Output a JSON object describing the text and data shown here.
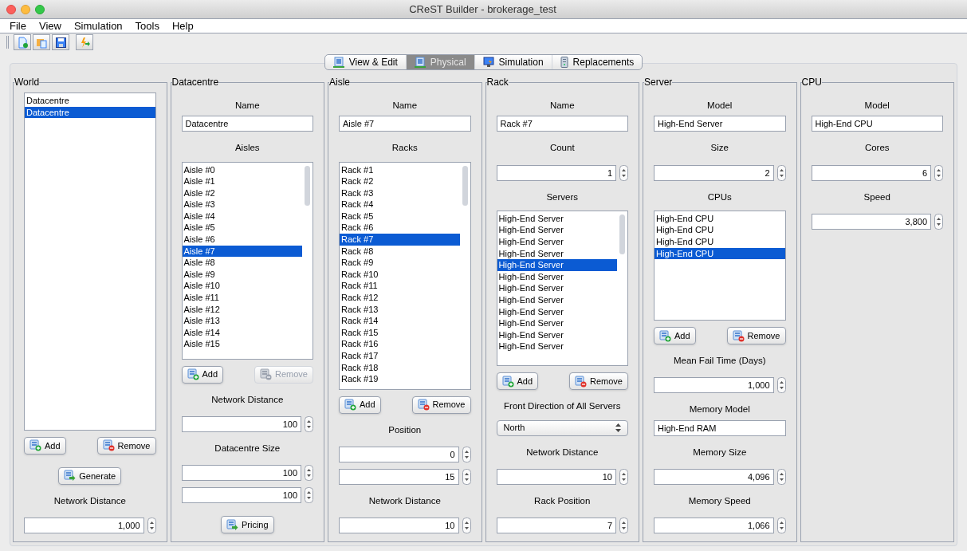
{
  "window": {
    "title": "CReST Builder - brokerage_test"
  },
  "menu": [
    "File",
    "View",
    "Simulation",
    "Tools",
    "Help"
  ],
  "tabs": [
    {
      "label": "View & Edit",
      "selected": false
    },
    {
      "label": "Physical",
      "selected": true
    },
    {
      "label": "Simulation",
      "selected": false
    },
    {
      "label": "Replacements",
      "selected": false
    }
  ],
  "panels": [
    {
      "title": "World",
      "items": [
        {
          "kind": "list",
          "rows": [
            {
              "text": "Datacentre",
              "selected": false
            },
            {
              "text": "Datacentre",
              "selected": true
            }
          ]
        },
        {
          "kind": "buttons",
          "buttons": [
            {
              "label": "Add",
              "disabled": false
            },
            {
              "label": "Remove",
              "disabled": false
            }
          ]
        },
        {
          "kind": "button",
          "label": "Generate"
        },
        {
          "kind": "label",
          "text": "Network Distance"
        },
        {
          "kind": "spinner",
          "value": "1,000"
        }
      ]
    },
    {
      "title": "Datacentre",
      "items": [
        {
          "kind": "label",
          "text": "Name"
        },
        {
          "kind": "text_field",
          "value": "Datacentre"
        },
        {
          "kind": "label",
          "text": "Aisles"
        },
        {
          "kind": "list",
          "rows": [
            {
              "text": "Aisle #0",
              "selected": false
            },
            {
              "text": "Aisle #1",
              "selected": false
            },
            {
              "text": "Aisle #2",
              "selected": false
            },
            {
              "text": "Aisle #3",
              "selected": false
            },
            {
              "text": "Aisle #4",
              "selected": false
            },
            {
              "text": "Aisle #5",
              "selected": false
            },
            {
              "text": "Aisle #6",
              "selected": false
            },
            {
              "text": "Aisle #7",
              "selected": true
            },
            {
              "text": "Aisle #8",
              "selected": false
            },
            {
              "text": "Aisle #9",
              "selected": false
            },
            {
              "text": "Aisle #10",
              "selected": false
            },
            {
              "text": "Aisle #11",
              "selected": false
            },
            {
              "text": "Aisle #12",
              "selected": false
            },
            {
              "text": "Aisle #13",
              "selected": false
            },
            {
              "text": "Aisle #14",
              "selected": false
            },
            {
              "text": "Aisle #15",
              "selected": false
            }
          ]
        },
        {
          "kind": "buttons",
          "buttons": [
            {
              "label": "Add",
              "disabled": false
            },
            {
              "label": "Remove",
              "disabled": true
            }
          ]
        },
        {
          "kind": "label",
          "text": "Network Distance"
        },
        {
          "kind": "spinner",
          "value": "100"
        },
        {
          "kind": "label",
          "text": "Datacentre Size"
        },
        {
          "kind": "spinner",
          "value": "100"
        },
        {
          "kind": "spinner",
          "value": "100"
        },
        {
          "kind": "button",
          "label": "Pricing"
        }
      ]
    },
    {
      "title": "Aisle",
      "items": [
        {
          "kind": "label",
          "text": "Name"
        },
        {
          "kind": "text_field",
          "value": "Aisle #7"
        },
        {
          "kind": "label",
          "text": "Racks"
        },
        {
          "kind": "list",
          "rows": [
            {
              "text": "Rack #1",
              "selected": false
            },
            {
              "text": "Rack #2",
              "selected": false
            },
            {
              "text": "Rack #3",
              "selected": false
            },
            {
              "text": "Rack #4",
              "selected": false
            },
            {
              "text": "Rack #5",
              "selected": false
            },
            {
              "text": "Rack #6",
              "selected": false
            },
            {
              "text": "Rack #7",
              "selected": true
            },
            {
              "text": "Rack #8",
              "selected": false
            },
            {
              "text": "Rack #9",
              "selected": false
            },
            {
              "text": "Rack #10",
              "selected": false
            },
            {
              "text": "Rack #11",
              "selected": false
            },
            {
              "text": "Rack #12",
              "selected": false
            },
            {
              "text": "Rack #13",
              "selected": false
            },
            {
              "text": "Rack #14",
              "selected": false
            },
            {
              "text": "Rack #15",
              "selected": false
            },
            {
              "text": "Rack #16",
              "selected": false
            },
            {
              "text": "Rack #17",
              "selected": false
            },
            {
              "text": "Rack #18",
              "selected": false
            },
            {
              "text": "Rack #19",
              "selected": false
            }
          ]
        },
        {
          "kind": "buttons",
          "buttons": [
            {
              "label": "Add",
              "disabled": false
            },
            {
              "label": "Remove",
              "disabled": false
            }
          ]
        },
        {
          "kind": "label",
          "text": "Position"
        },
        {
          "kind": "spinner",
          "value": "0"
        },
        {
          "kind": "spinner",
          "value": "15"
        },
        {
          "kind": "label",
          "text": "Network Distance"
        },
        {
          "kind": "spinner",
          "value": "10"
        }
      ]
    },
    {
      "title": "Rack",
      "items": [
        {
          "kind": "label",
          "text": "Name"
        },
        {
          "kind": "text_field",
          "value": "Rack #7"
        },
        {
          "kind": "label",
          "text": "Count"
        },
        {
          "kind": "spinner",
          "value": "1"
        },
        {
          "kind": "label",
          "text": "Servers"
        },
        {
          "kind": "list",
          "rows": [
            {
              "text": "High-End Server",
              "selected": false
            },
            {
              "text": "High-End Server",
              "selected": false
            },
            {
              "text": "High-End Server",
              "selected": false
            },
            {
              "text": "High-End Server",
              "selected": false
            },
            {
              "text": "High-End Server",
              "selected": true
            },
            {
              "text": "High-End Server",
              "selected": false
            },
            {
              "text": "High-End Server",
              "selected": false
            },
            {
              "text": "High-End Server",
              "selected": false
            },
            {
              "text": "High-End Server",
              "selected": false
            },
            {
              "text": "High-End Server",
              "selected": false
            },
            {
              "text": "High-End Server",
              "selected": false
            },
            {
              "text": "High-End Server",
              "selected": false
            }
          ]
        },
        {
          "kind": "buttons",
          "buttons": [
            {
              "label": "Add",
              "disabled": false
            },
            {
              "label": "Remove",
              "disabled": false
            }
          ]
        },
        {
          "kind": "label",
          "text": "Front Direction of All Servers"
        },
        {
          "kind": "select",
          "value": "North"
        },
        {
          "kind": "label",
          "text": "Network Distance"
        },
        {
          "kind": "spinner",
          "value": "10"
        },
        {
          "kind": "label",
          "text": "Rack Position"
        },
        {
          "kind": "spinner",
          "value": "7"
        }
      ]
    },
    {
      "title": "Server",
      "items": [
        {
          "kind": "label",
          "text": "Model"
        },
        {
          "kind": "text_field",
          "value": "High-End Server"
        },
        {
          "kind": "label",
          "text": "Size"
        },
        {
          "kind": "spinner",
          "value": "2"
        },
        {
          "kind": "label",
          "text": "CPUs"
        },
        {
          "kind": "list",
          "rows": [
            {
              "text": "High-End CPU",
              "selected": false
            },
            {
              "text": "High-End CPU",
              "selected": false
            },
            {
              "text": "High-End CPU",
              "selected": false
            },
            {
              "text": "High-End CPU",
              "selected": true
            }
          ]
        },
        {
          "kind": "buttons",
          "buttons": [
            {
              "label": "Add",
              "disabled": false
            },
            {
              "label": "Remove",
              "disabled": false
            }
          ]
        },
        {
          "kind": "label",
          "text": "Mean Fail Time (Days)"
        },
        {
          "kind": "spinner",
          "value": "1,000"
        },
        {
          "kind": "label",
          "text": "Memory Model"
        },
        {
          "kind": "text_field",
          "value": "High-End RAM"
        },
        {
          "kind": "label",
          "text": "Memory Size"
        },
        {
          "kind": "spinner",
          "value": "4,096"
        },
        {
          "kind": "label",
          "text": "Memory Speed"
        },
        {
          "kind": "spinner",
          "value": "1,066"
        }
      ]
    },
    {
      "title": "CPU",
      "items": [
        {
          "kind": "label",
          "text": "Model"
        },
        {
          "kind": "text_field",
          "value": "High-End CPU"
        },
        {
          "kind": "label",
          "text": "Cores"
        },
        {
          "kind": "spinner",
          "value": "6"
        },
        {
          "kind": "label",
          "text": "Speed"
        },
        {
          "kind": "spinner",
          "value": "3,800"
        }
      ]
    }
  ]
}
